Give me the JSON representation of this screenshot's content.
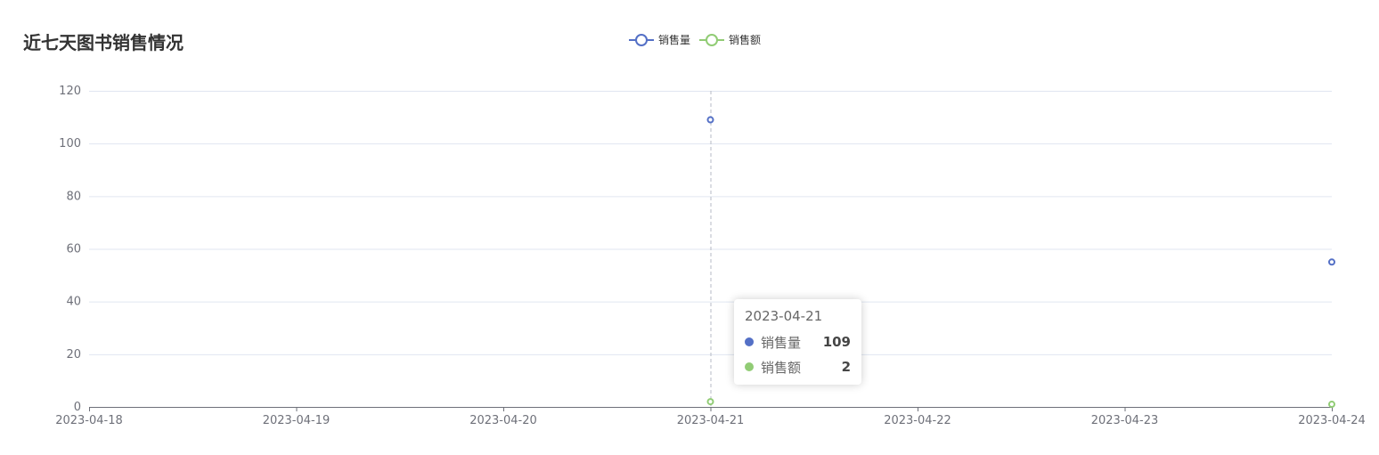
{
  "title": "近七天图书销售情况",
  "legend": [
    {
      "name": "销售量",
      "color": "#5470c6"
    },
    {
      "name": "销售额",
      "color": "#91cc75"
    }
  ],
  "chart_data": {
    "type": "line",
    "title": "近七天图书销售情况",
    "categories": [
      "2023-04-18",
      "2023-04-19",
      "2023-04-20",
      "2023-04-21",
      "2023-04-22",
      "2023-04-23",
      "2023-04-24"
    ],
    "ylim": [
      0,
      120
    ],
    "yticks": [
      0,
      20,
      40,
      60,
      80,
      100,
      120
    ],
    "grid": true,
    "legend_position": "top-center",
    "series": [
      {
        "name": "销售量",
        "color": "#5470c6",
        "values": [
          null,
          null,
          null,
          109,
          null,
          null,
          55
        ]
      },
      {
        "name": "销售额",
        "color": "#91cc75",
        "values": [
          null,
          null,
          null,
          2,
          null,
          null,
          1
        ]
      }
    ]
  },
  "tooltip": {
    "title": "2023-04-21",
    "rows": [
      {
        "name": "销售量",
        "value": "109",
        "color": "#5470c6"
      },
      {
        "name": "销售额",
        "value": "2",
        "color": "#91cc75"
      }
    ]
  }
}
